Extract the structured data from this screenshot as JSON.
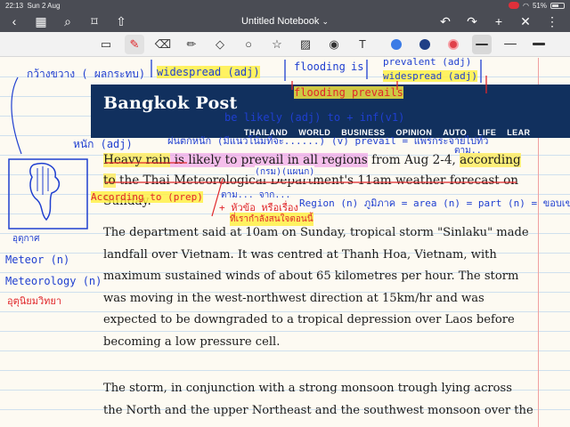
{
  "status": {
    "time": "22:13",
    "date": "Sun 2 Aug",
    "battery": "51%"
  },
  "nav": {
    "title": "Untitled Notebook",
    "caret": "⌄"
  },
  "toolbar": {
    "tools": [
      "lasso-tool",
      "pen-tool",
      "eraser-tool",
      "highlighter-tool",
      "shapes-tool",
      "lasso-select-tool",
      "star-tool",
      "image-tool",
      "camera-tool",
      "text-tool"
    ],
    "colors": [
      "#3b7be6",
      "#1f3f86",
      "#e0414a"
    ]
  },
  "banner": {
    "logo": "Bangkok Post",
    "links": [
      "THAILAND",
      "WORLD",
      "BUSINESS",
      "OPINION",
      "AUTO",
      "LIFE",
      "LEAR"
    ]
  },
  "article": {
    "lead_1": "Heavy rain",
    "lead_2": " is likely to prevail in all regions",
    "lead_3": " from Aug 2-4, ",
    "lead_4": "according to",
    "lead_5": " the Thai Meteorological Department's 11am weather forecast on Sunday.",
    "p2": "The department said at 10am on Sunday, tropical storm \"Sinlaku\" made landfall over Vietnam. It was centred at Thanh Hoa, Vietnam, with maximum sustained winds of about 65 kilometres per hour. The storm was moving in the west-northwest direction at 15km/hr and was expected to be downgraded to a tropical depression over Laos before becoming a low pressure cell.",
    "p3": "The storm, in conjunction with a strong monsoon trough lying across the North and the upper Northeast and the southwest monsoon over the"
  },
  "annotations": {
    "top_left": "กว้างขวาง ( ผลกระทบ)",
    "widespread": "widespread (adj)",
    "flooding": "flooding",
    "is": "is",
    "prevalent": "prevalent (adj)",
    "widespread_right": "widespread (adj)",
    "flooding_prevails": "flooding prevails",
    "be_likely": "be likely (adj) to + inf(v1)",
    "heavy_adj": "หนัก (adj)",
    "rain_th": "ฝนตกหนัก (มีแนวโน้มที่จะ......)",
    "prevail_v": "(v) prevail = แพร่กระจายไปทั่ว",
    "taam": "ตาม..",
    "krom": "(กรม)(แผนก)",
    "according_prep": "According to (prep)",
    "taam_jaak": "ตาม... จาก...",
    "hua_kho": "+ หัวข้อ หรือเรื่อง",
    "thi_rao": "ที่เรากำลังสนใจตอนนี้",
    "region": "Region (n) ภูมิภาค = area (n) = part (n) = ขอบเขต",
    "udom": "อุตุกาศ",
    "meteor": "Meteor (n)",
    "meteorology": "Meteorology (n)",
    "utuniyom": "อุตุนิยมวิทยา"
  }
}
